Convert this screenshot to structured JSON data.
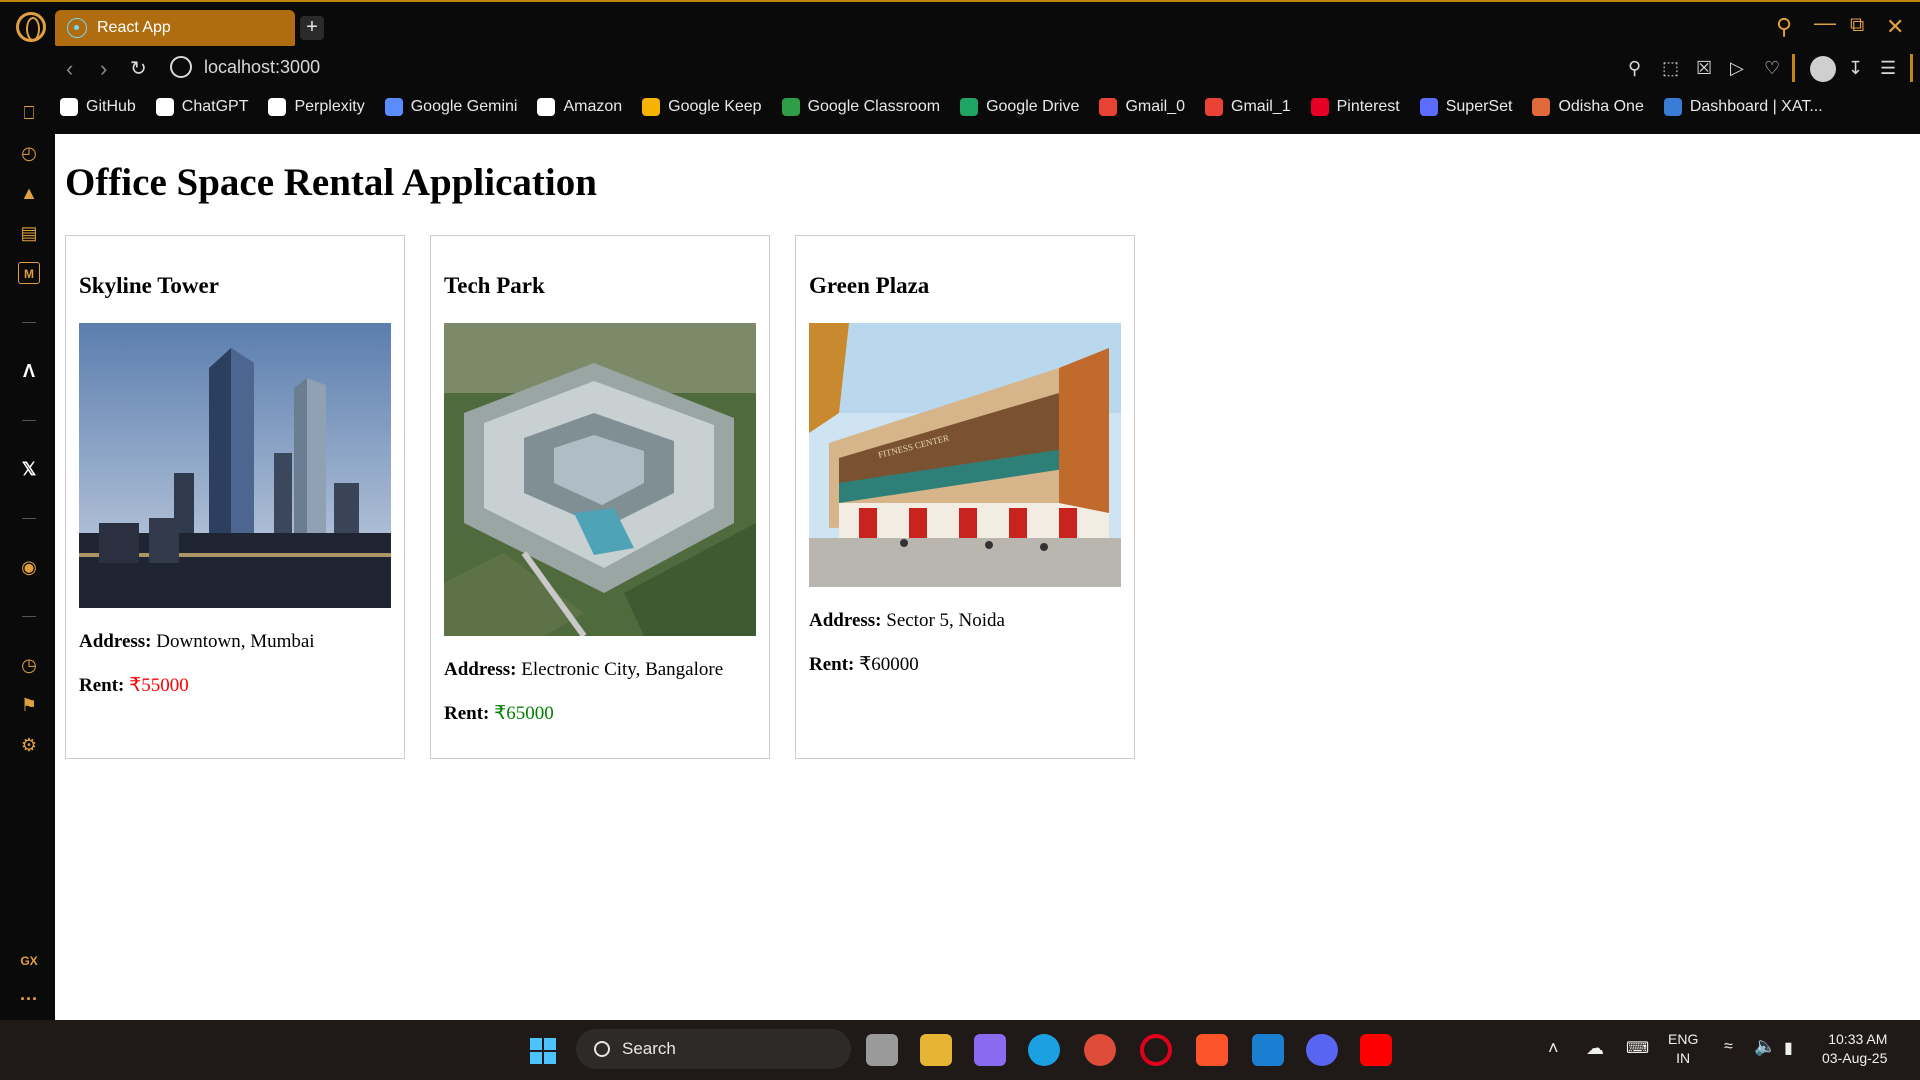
{
  "browser": {
    "tab_title": "React App",
    "new_tab_symbol": "+",
    "url": "localhost:3000"
  },
  "bookmarks": [
    {
      "label": "GitHub",
      "icon": "github-icon",
      "color": "#ffffff"
    },
    {
      "label": "ChatGPT",
      "icon": "chatgpt-icon",
      "color": "#ffffff"
    },
    {
      "label": "Perplexity",
      "icon": "perplexity-icon",
      "color": "#ffffff"
    },
    {
      "label": "Google Gemini",
      "icon": "gemini-icon",
      "color": "#5b8cff"
    },
    {
      "label": "Amazon",
      "icon": "amazon-icon",
      "color": "#ffffff"
    },
    {
      "label": "Google Keep",
      "icon": "keep-icon",
      "color": "#f6b400"
    },
    {
      "label": "Google Classroom",
      "icon": "classroom-icon",
      "color": "#2e9e48"
    },
    {
      "label": "Google Drive",
      "icon": "drive-icon",
      "color": "#1fa463"
    },
    {
      "label": "Gmail_0",
      "icon": "gmail-icon",
      "color": "#ea4335"
    },
    {
      "label": "Gmail_1",
      "icon": "gmail-icon",
      "color": "#ea4335"
    },
    {
      "label": "Pinterest",
      "icon": "pinterest-icon",
      "color": "#e60023"
    },
    {
      "label": "SuperSet",
      "icon": "superset-icon",
      "color": "#5b6cff"
    },
    {
      "label": "Odisha One",
      "icon": "odisha-one-icon",
      "color": "#e06a3a"
    },
    {
      "label": "Dashboard | XAT...",
      "icon": "xat-icon",
      "color": "#3a7bd5"
    }
  ],
  "page": {
    "title": "Office Space Rental Application",
    "address_label": "Address:",
    "rent_label": "Rent:"
  },
  "offices": [
    {
      "name": "Skyline Tower",
      "address": "Downtown, Mumbai",
      "rent": "₹55000",
      "rent_color": "#ff0000"
    },
    {
      "name": "Tech Park",
      "address": "Electronic City, Bangalore",
      "rent": "₹65000",
      "rent_color": "#008000"
    },
    {
      "name": "Green Plaza",
      "address": "Sector 5, Noida",
      "rent": "₹60000",
      "rent_color": "#000000"
    }
  ],
  "green_plaza_sign": "FITNESS CENTER",
  "taskbar": {
    "search_label": "Search",
    "language": "ENG",
    "region": "IN",
    "time": "10:33 AM",
    "date": "03-Aug-25"
  },
  "sidebar": {
    "gx_label": "GX",
    "more_label": "···"
  },
  "colors": {
    "accent": "#c2860c",
    "tab_active": "#b06d10"
  }
}
